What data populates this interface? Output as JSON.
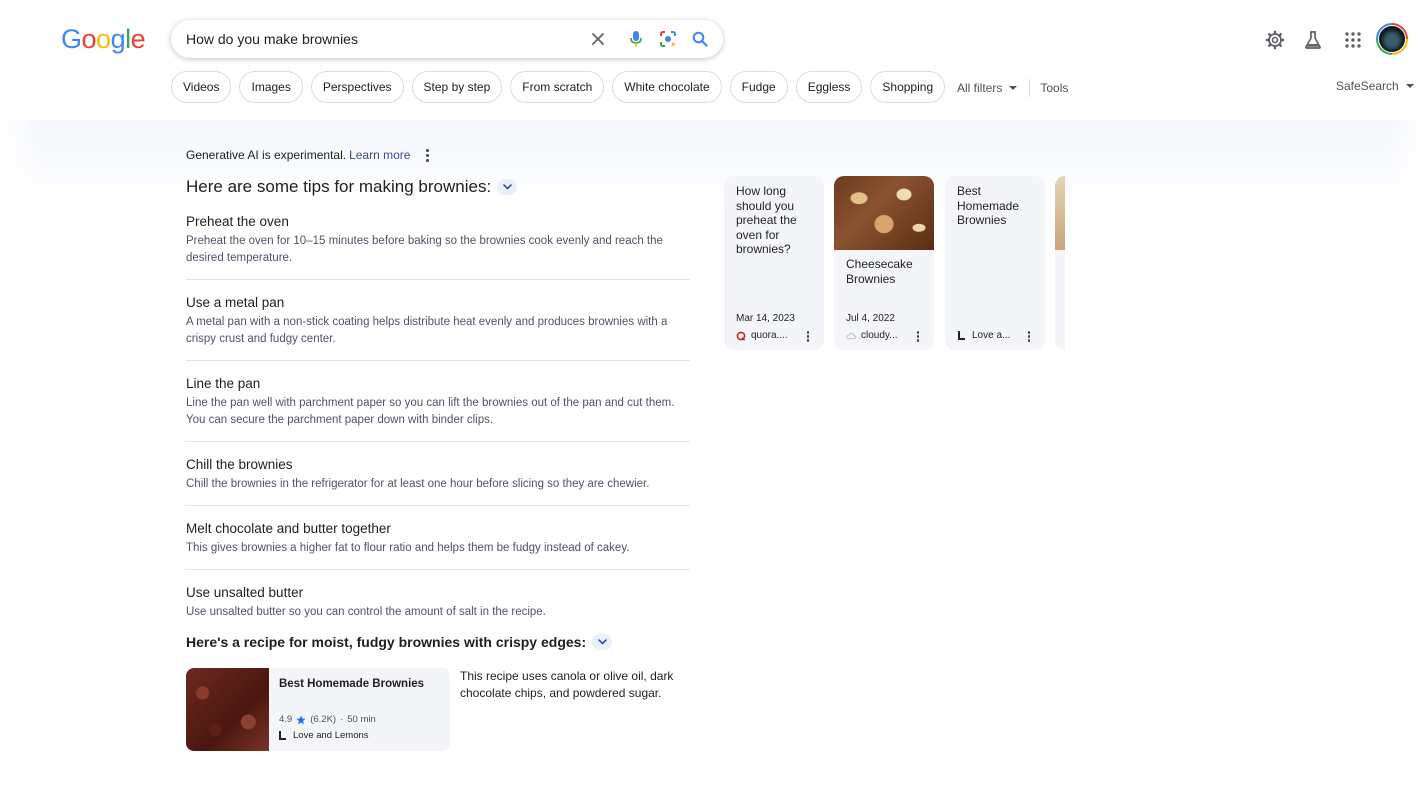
{
  "brand": {
    "logo_letters": [
      {
        "char": "G",
        "color": "#4285f4"
      },
      {
        "char": "o",
        "color": "#ea4335"
      },
      {
        "char": "o",
        "color": "#fbbc05"
      },
      {
        "char": "g",
        "color": "#4285f4"
      },
      {
        "char": "l",
        "color": "#34a853"
      },
      {
        "char": "e",
        "color": "#ea4335"
      }
    ]
  },
  "search": {
    "query": "How do you make brownies",
    "icons": [
      "clear-icon",
      "microphone-icon",
      "lens-icon",
      "search-icon"
    ]
  },
  "header_icons": [
    "settings-icon",
    "labs-flask-icon",
    "apps-grid-icon",
    "account-avatar"
  ],
  "chips": [
    "Videos",
    "Images",
    "Perspectives",
    "Step by step",
    "From scratch",
    "White chocolate",
    "Fudge",
    "Eggless",
    "Shopping"
  ],
  "filters": {
    "all_filters": "All filters",
    "tools": "Tools",
    "safesearch": "SafeSearch"
  },
  "ai_overview": {
    "disclaimer": "Generative AI is experimental.",
    "learn_more": "Learn more",
    "heading": "Here are some tips for making brownies:",
    "tips": [
      {
        "title": "Preheat the oven",
        "body": "Preheat the oven for 10–15 minutes before baking so the brownies cook evenly and reach the desired temperature."
      },
      {
        "title": "Use a metal pan",
        "body": "A metal pan with a non-stick coating helps distribute heat evenly and produces brownies with a crispy crust and fudgy center."
      },
      {
        "title": "Line the pan",
        "body": "Line the pan well with parchment paper so you can lift the brownies out of the pan and cut them. You can secure the parchment paper down with binder clips."
      },
      {
        "title": "Chill the brownies",
        "body": "Chill the brownies in the refrigerator for at least one hour before slicing so they are chewier."
      },
      {
        "title": "Melt chocolate and butter together",
        "body": "This gives brownies a higher fat to flour ratio and helps them be fudgy instead of cakey."
      },
      {
        "title": "Use unsalted butter",
        "body": "Use unsalted butter so you can control the amount of salt in the recipe."
      }
    ],
    "recipe_heading": "Here's a recipe for moist, fudgy brownies with crispy edges:",
    "recipe": {
      "title": "Best Homemade Brownies",
      "rating": "4.9",
      "reviews": "(6.2K)",
      "time": "50 min",
      "source": "Love and Lemons",
      "description": "This recipe uses canola or olive oil, dark chocolate chips, and powdered sugar."
    }
  },
  "source_cards": [
    {
      "title": "How long should you preheat the oven for brownies?",
      "date": "Mar 14, 2023",
      "source": "quora....",
      "source_icon_color": "#b92b27",
      "has_image": false
    },
    {
      "title": "Cheesecake Brownies",
      "date": "Jul 4, 2022",
      "source": "cloudy...",
      "source_icon_color": "#bdbdbd",
      "has_image": true
    },
    {
      "title": "Best Homemade Brownies",
      "date": "",
      "source": "Love a...",
      "source_icon_color": "#202124",
      "has_image": false
    }
  ],
  "colors": {
    "link": "#3c4a8a",
    "star": "#1a73e8",
    "chip_border": "#dadce0",
    "card_bg": "#f3f5f8"
  }
}
